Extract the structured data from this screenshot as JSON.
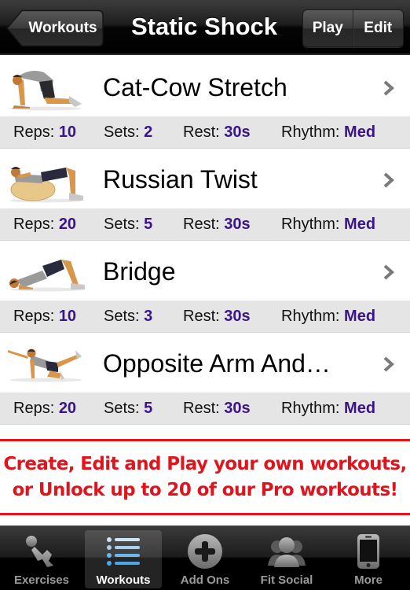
{
  "navbar": {
    "back_label": "Workouts",
    "title": "Static Shock",
    "play_label": "Play",
    "edit_label": "Edit"
  },
  "stat_labels": {
    "reps": "Reps:",
    "sets": "Sets:",
    "rest": "Rest:",
    "rhythm": "Rhythm:"
  },
  "exercises": [
    {
      "name": "Cat-Cow Stretch",
      "thumbnail_icon": "cat-cow-stretch-figure",
      "reps": "10",
      "sets": "2",
      "rest": "30s",
      "rhythm": "Med"
    },
    {
      "name": "Russian Twist",
      "thumbnail_icon": "russian-twist-figure",
      "reps": "20",
      "sets": "5",
      "rest": "30s",
      "rhythm": "Med"
    },
    {
      "name": "Bridge",
      "thumbnail_icon": "bridge-figure",
      "reps": "10",
      "sets": "3",
      "rest": "30s",
      "rhythm": "Med"
    },
    {
      "name": "Opposite Arm And…",
      "thumbnail_icon": "opposite-arm-leg-figure",
      "reps": "20",
      "sets": "5",
      "rest": "30s",
      "rhythm": "Med"
    }
  ],
  "promo": {
    "line1": "Create, Edit and Play your own workouts,",
    "line2": "or Unlock up to 20 of our Pro workouts!"
  },
  "tabbar": {
    "items": [
      {
        "label": "Exercises",
        "icon": "exercise-figure-icon",
        "active": false
      },
      {
        "label": "Workouts",
        "icon": "list-icon",
        "active": true
      },
      {
        "label": "Add Ons",
        "icon": "plus-circle-icon",
        "active": false
      },
      {
        "label": "Fit Social",
        "icon": "people-icon",
        "active": false
      },
      {
        "label": "More",
        "icon": "phone-icon",
        "active": false
      }
    ]
  },
  "colors": {
    "value_accent": "#3a1488",
    "promo_red": "#e0141c",
    "stats_bg": "#e5e5e5",
    "active_tab_icon_blue": "#4aa8e8"
  }
}
